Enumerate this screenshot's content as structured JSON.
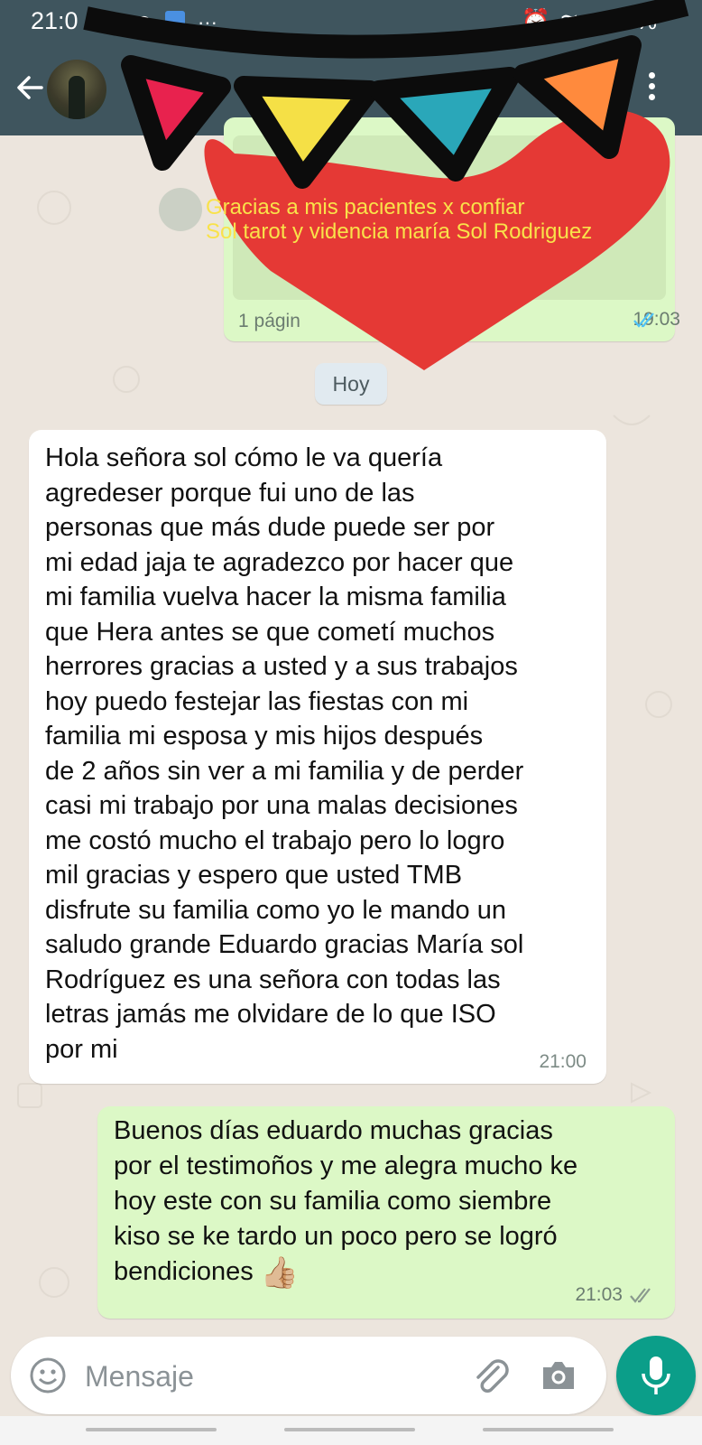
{
  "status_bar": {
    "time": "21:0",
    "battery": "35%"
  },
  "banner": {
    "line1": "Gracias a mis pacientes x confiar",
    "line2": "Sol tarot y videncia  maría Sol Rodriguez"
  },
  "document_message": {
    "hashtag": "#",
    "pages": "1 págin",
    "time": "19:03"
  },
  "day_separator": "Hoy",
  "incoming_message": {
    "text": "Hola señora sol cómo le va  quería\nagredeser   porque fui uno de las\npersonas que más dude puede ser por\nmi edad jaja  te agradezco por hacer que\nmi familia vuelva hacer la misma familia\nque Hera antes se que cometí muchos\nherrores gracias a usted y a sus trabajos\nhoy puedo festejar las fiestas con mi\nfamilia mi esposa y mis hijos después\nde 2 años sin ver a mi familia y de perder\ncasi mi trabajo por una malas decisiones\nme costó mucho el trabajo pero lo logro\nmil gracias y espero que usted TMB\ndisfrute su familia como yo   le mando un\nsaludo grande Eduardo gracias María sol\nRodríguez  es una señora con todas las\nletras jamás me olvidare de lo que ISO\npor mi",
    "time": "21:00"
  },
  "outgoing_message": {
    "text": "Buenos días eduardo  muchas gracias\npor el testimoños y me alegra mucho ke\nhoy este con su familia como siembre\nkiso se ke tardo un poco pero se logró\nbendiciones",
    "emoji": "👍🏼",
    "time": "21:03"
  },
  "composer": {
    "placeholder": "Mensaje"
  },
  "colors": {
    "header": "#3f555e",
    "chat_background": "#ece5dd",
    "outgoing_bubble": "#dcf8c6",
    "incoming_bubble": "#ffffff",
    "mic_button": "#0b9e89",
    "read_ticks": "#4fc3f7",
    "heart": "#e53935",
    "banner_text": "#f9e24a"
  },
  "icons": [
    "back-arrow-icon",
    "menu-dots-icon",
    "emoji-icon",
    "attach-icon",
    "camera-icon",
    "mic-icon",
    "read-ticks-icon"
  ]
}
